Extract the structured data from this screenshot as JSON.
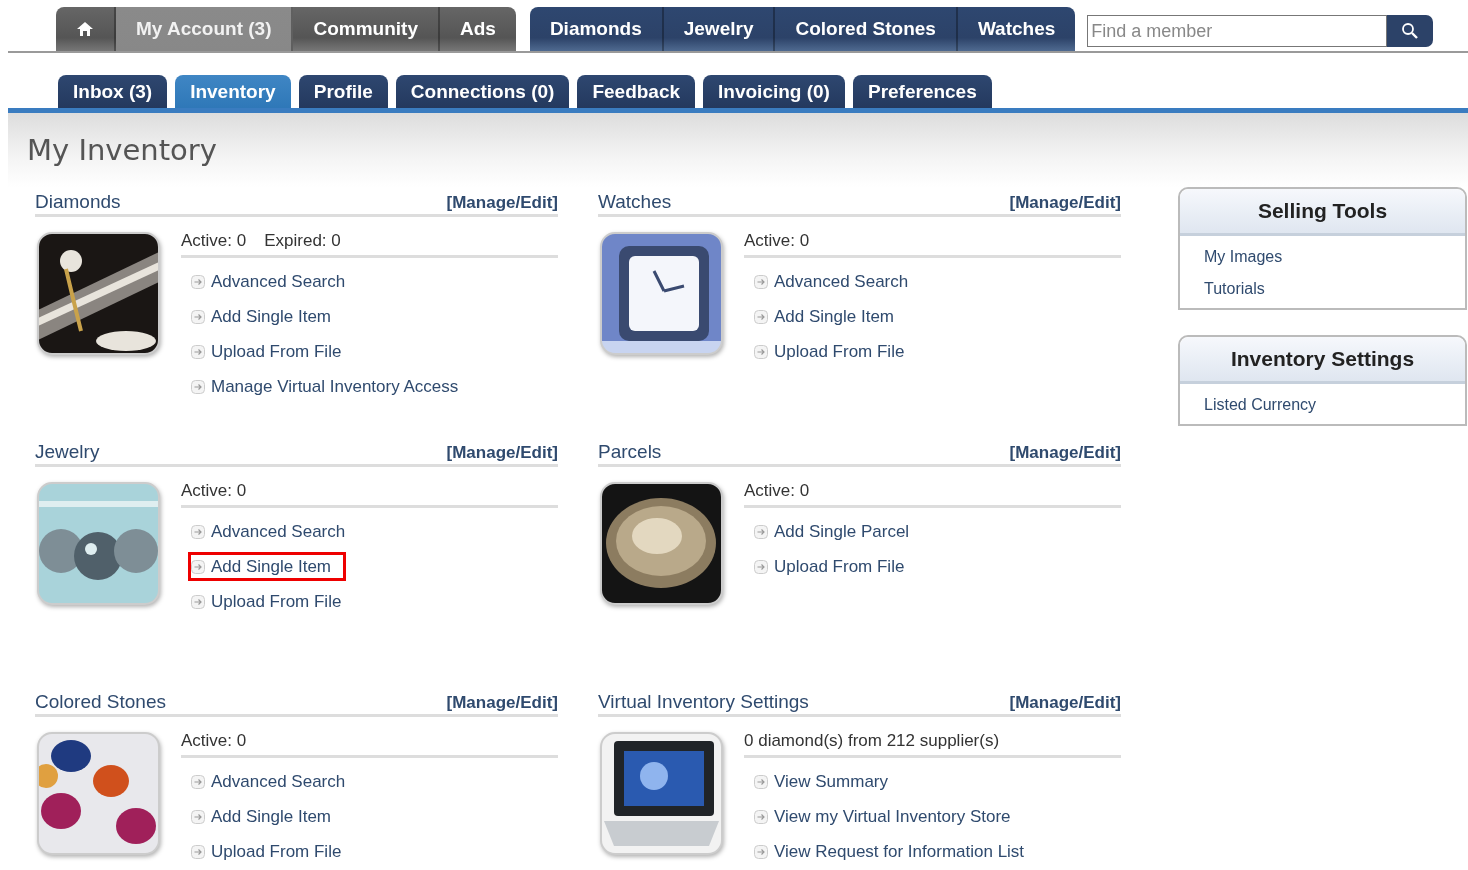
{
  "top_nav": {
    "account_tabs": [
      {
        "kind": "home",
        "selected": false
      },
      {
        "label": "My Account (3)",
        "selected": true
      },
      {
        "label": "Community",
        "selected": false
      },
      {
        "label": "Ads",
        "selected": false
      }
    ],
    "market_tabs": [
      {
        "label": "Diamonds"
      },
      {
        "label": "Jewelry"
      },
      {
        "label": "Colored Stones"
      },
      {
        "label": "Watches"
      }
    ],
    "search": {
      "placeholder": "Find a member"
    }
  },
  "sub_tabs": [
    {
      "label": "Inbox (3)",
      "selected": false
    },
    {
      "label": "Inventory",
      "selected": true
    },
    {
      "label": "Profile",
      "selected": false
    },
    {
      "label": "Connections (0)",
      "selected": false
    },
    {
      "label": "Feedback",
      "selected": false
    },
    {
      "label": "Invoicing (0)",
      "selected": false
    },
    {
      "label": "Preferences",
      "selected": false
    }
  ],
  "page_title": "My Inventory",
  "sections": [
    {
      "title": "Diamonds",
      "manage": "[Manage/Edit]",
      "picture": {
        "kind": "picture"
      },
      "stats": [
        "Active: 0",
        "Expired: 0"
      ],
      "links": [
        {
          "label": "Advanced Search",
          "highlighted": false
        },
        {
          "label": "Add Single Item",
          "highlighted": false
        },
        {
          "label": "Upload From File",
          "highlighted": false
        },
        {
          "label": "Manage Virtual Inventory Access",
          "highlighted": false
        }
      ]
    },
    {
      "title": "Watches",
      "manage": "[Manage/Edit]",
      "picture": {
        "kind": "picture"
      },
      "stats": [
        "Active: 0"
      ],
      "links": [
        {
          "label": "Advanced Search",
          "highlighted": false
        },
        {
          "label": "Add Single Item",
          "highlighted": false
        },
        {
          "label": "Upload From File",
          "highlighted": false
        }
      ]
    },
    {
      "title": "Jewelry",
      "manage": "[Manage/Edit]",
      "picture": {
        "kind": "picture"
      },
      "stats": [
        "Active: 0"
      ],
      "links": [
        {
          "label": "Advanced Search",
          "highlighted": false
        },
        {
          "label": "Add Single Item",
          "highlighted": true
        },
        {
          "label": "Upload From File",
          "highlighted": false
        }
      ]
    },
    {
      "title": "Parcels",
      "manage": "[Manage/Edit]",
      "picture": {
        "kind": "picture"
      },
      "stats": [
        "Active: 0"
      ],
      "links": [
        {
          "label": "Add Single Parcel",
          "highlighted": false
        },
        {
          "label": "Upload From File",
          "highlighted": false
        }
      ]
    },
    {
      "title": "Colored Stones",
      "manage": "[Manage/Edit]",
      "picture": {
        "kind": "picture"
      },
      "stats": [
        "Active: 0"
      ],
      "links": [
        {
          "label": "Advanced Search",
          "highlighted": false
        },
        {
          "label": "Add Single Item",
          "highlighted": false
        },
        {
          "label": "Upload From File",
          "highlighted": false
        }
      ]
    },
    {
      "title": "Virtual Inventory Settings",
      "manage": "[Manage/Edit]",
      "picture": {
        "kind": "picture"
      },
      "stats": [
        "0 diamond(s) from 212 supplier(s)"
      ],
      "links": [
        {
          "label": "View Summary",
          "highlighted": false
        },
        {
          "label": "View my Virtual Inventory Store",
          "highlighted": false
        },
        {
          "label": "View Request for Information List",
          "highlighted": false
        }
      ]
    }
  ],
  "sidebar": [
    {
      "title": "Selling Tools",
      "links": [
        "My Images",
        "Tutorials"
      ]
    },
    {
      "title": "Inventory Settings",
      "links": [
        "Listed Currency"
      ]
    }
  ]
}
